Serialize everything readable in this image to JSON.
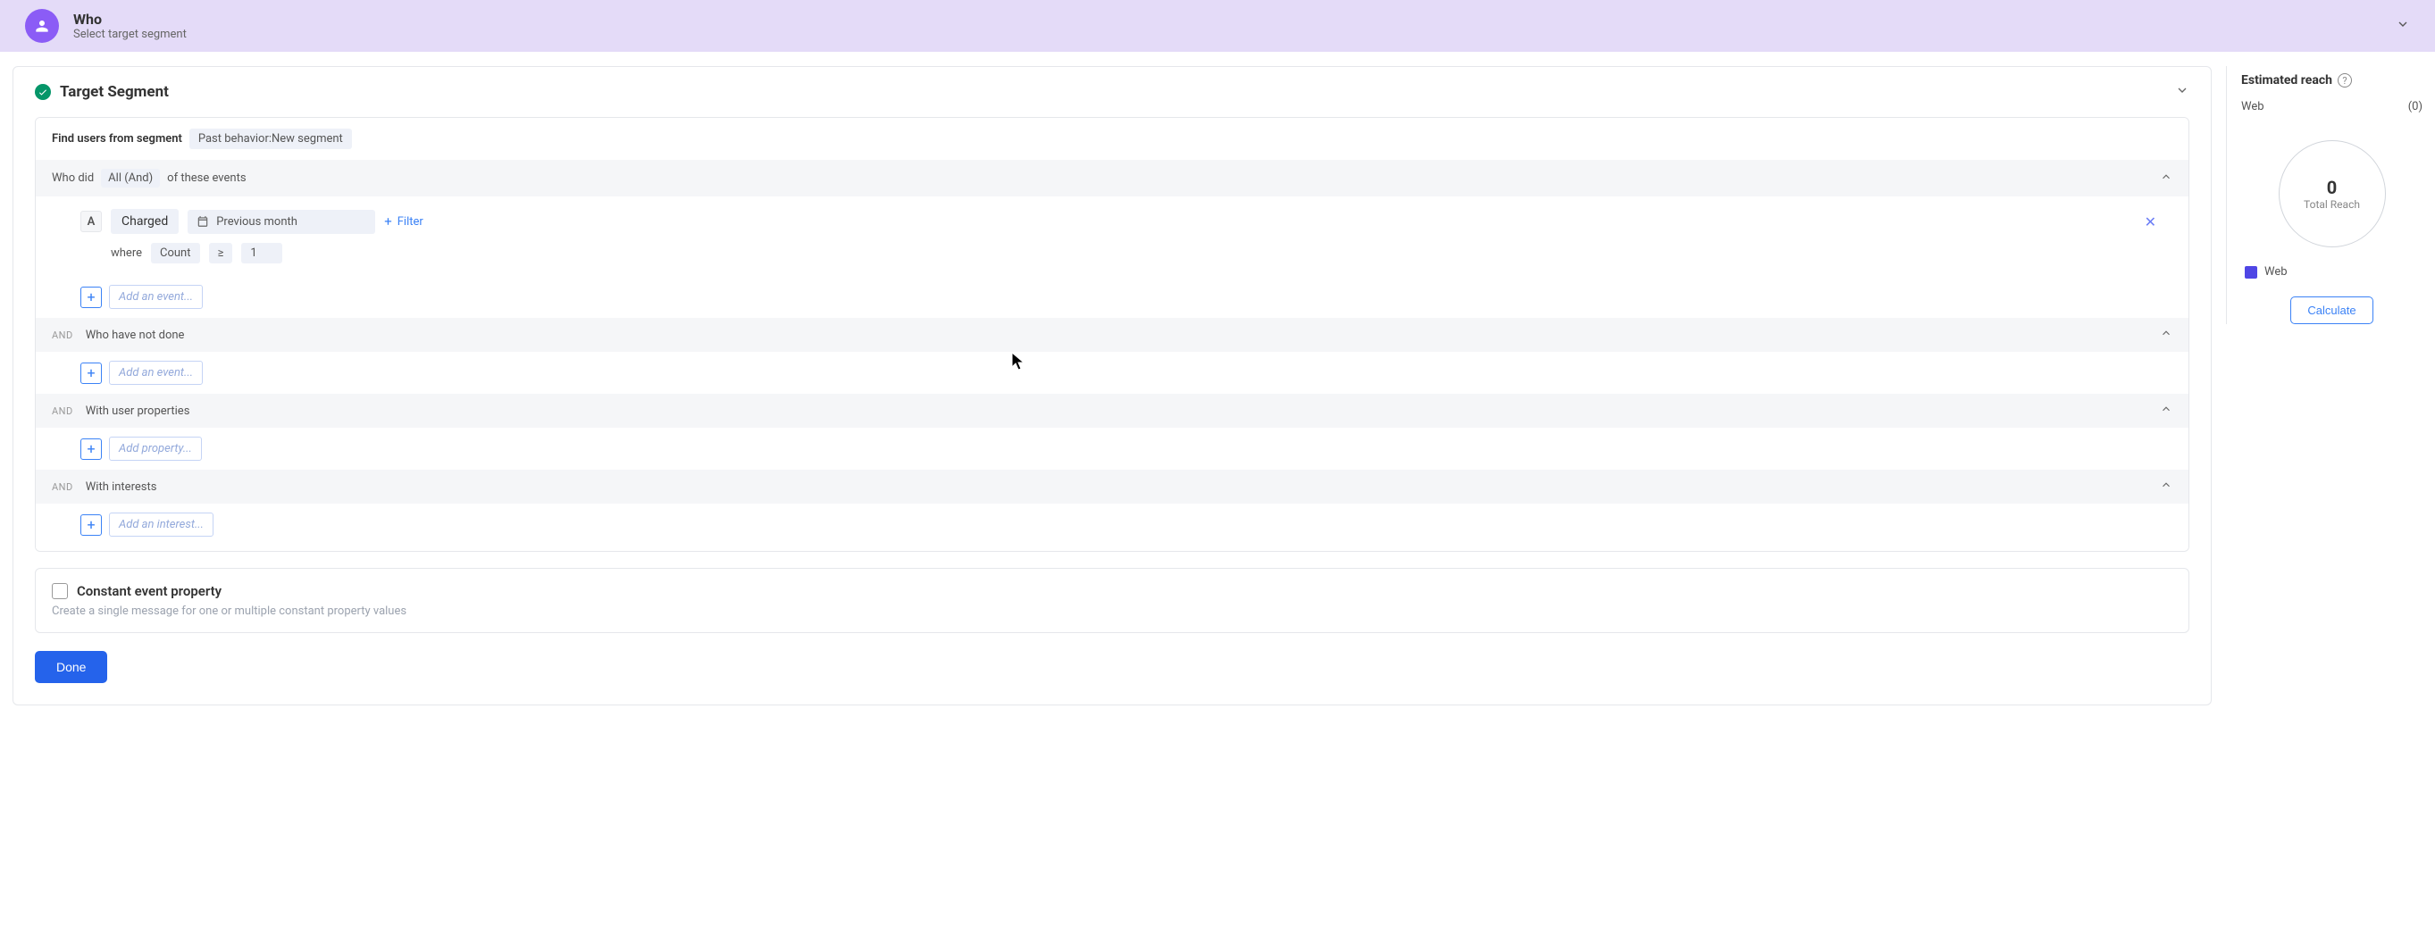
{
  "banner": {
    "title": "Who",
    "subtitle": "Select target segment"
  },
  "target": {
    "title": "Target Segment",
    "find_label": "Find users from  segment",
    "segment_chip": "Past behavior:New segment"
  },
  "who_did": {
    "prefix": "Who did",
    "condition": "All (And)",
    "suffix": "of these events"
  },
  "event_a": {
    "letter": "A",
    "name": "Charged",
    "date_range": "Previous month",
    "filter_label": "Filter",
    "where": "where",
    "metric": "Count",
    "operator": "≥",
    "value": "1"
  },
  "add_labels": {
    "add_event": "Add an event...",
    "add_property": "Add property...",
    "add_interest": "Add an interest..."
  },
  "sections": {
    "not_done": "Who have not done",
    "user_props": "With user properties",
    "interests": "With interests",
    "and": "AND"
  },
  "constant": {
    "title": "Constant event property",
    "subtitle": "Create a single message for one or multiple constant property values"
  },
  "done": "Done",
  "reach": {
    "title": "Estimated reach",
    "web_label": "Web",
    "web_count": "(0)",
    "total_num": "0",
    "total_label": "Total Reach",
    "legend_label": "Web",
    "calculate": "Calculate"
  }
}
